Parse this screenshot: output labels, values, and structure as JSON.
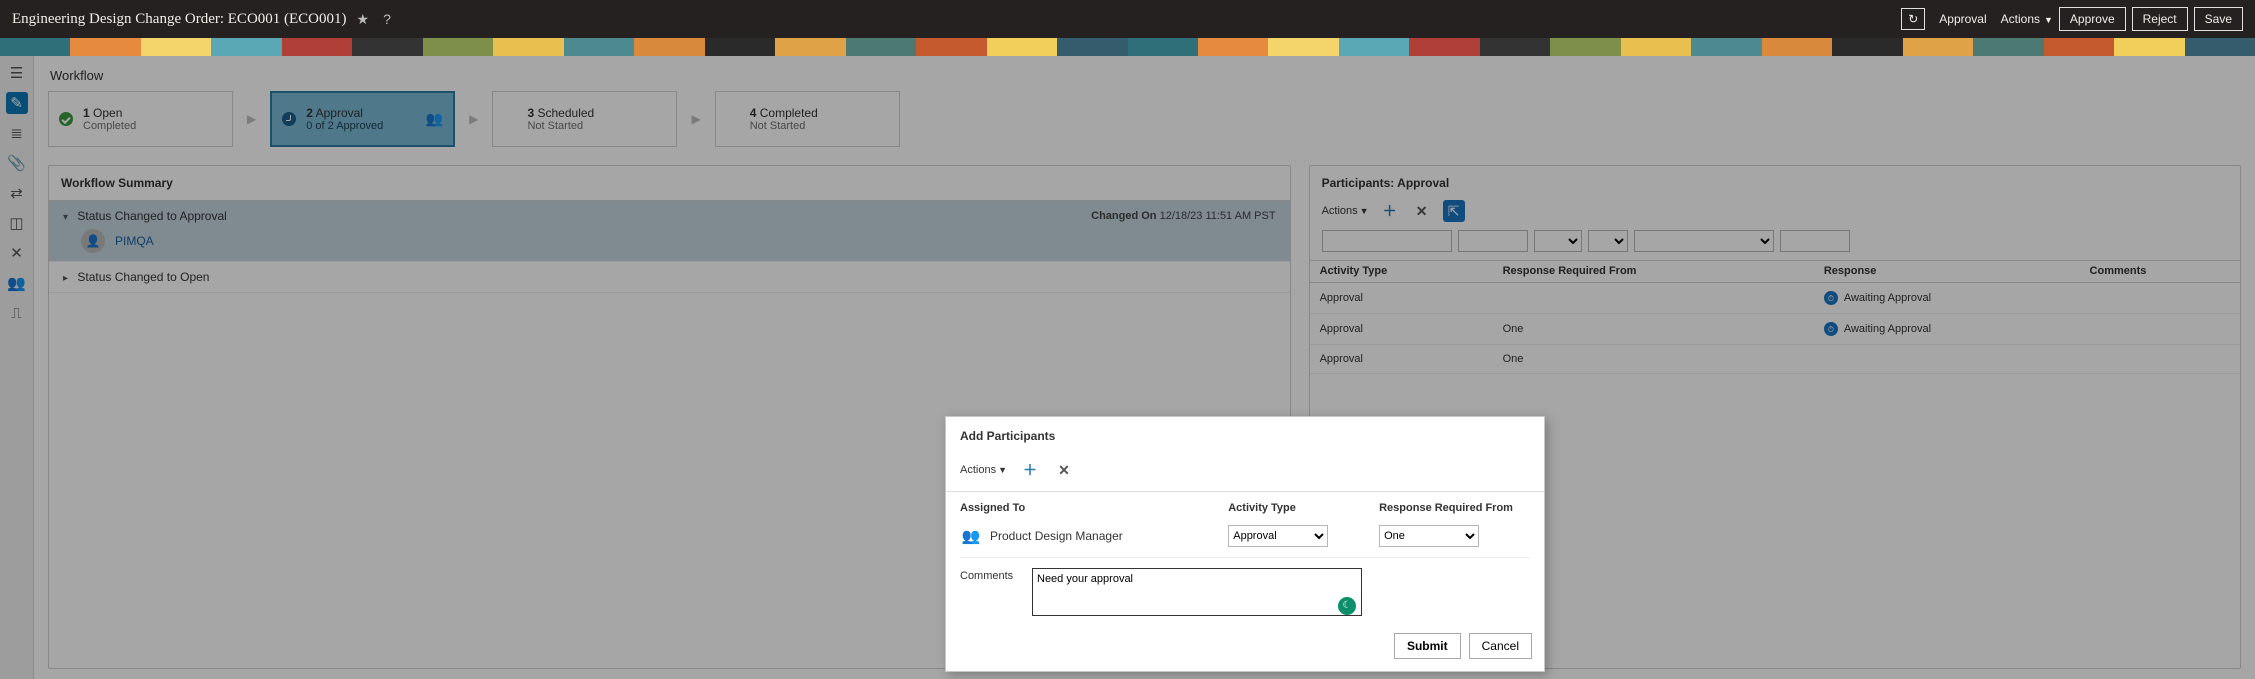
{
  "header": {
    "title": "Engineering Design Change Order: ECO001 (ECO001)",
    "approval_text": "Approval",
    "actions_text": "Actions",
    "approve_btn": "Approve",
    "reject_btn": "Reject",
    "save_btn": "Save"
  },
  "rail_icons": [
    "clipboard",
    "form",
    "list",
    "paperclip",
    "workflow",
    "chart",
    "nodes",
    "people",
    "timeline"
  ],
  "workflow": {
    "title": "Workflow",
    "steps": [
      {
        "num": "1",
        "name": "Open",
        "sub": "Completed",
        "state": "done"
      },
      {
        "num": "2",
        "name": "Approval",
        "sub": "0 of 2 Approved",
        "state": "active"
      },
      {
        "num": "3",
        "name": "Scheduled",
        "sub": "Not Started",
        "state": "future"
      },
      {
        "num": "4",
        "name": "Completed",
        "sub": "Not Started",
        "state": "future"
      }
    ]
  },
  "summary": {
    "title": "Workflow Summary",
    "events": [
      {
        "toggle": "down",
        "label": "Status Changed to Approval",
        "right_label": "Changed On",
        "right_value": "12/18/23 11:51 AM PST",
        "user": "PIMQA",
        "current": true
      },
      {
        "toggle": "right",
        "label": "Status Changed to Open",
        "right_label": "",
        "right_value": "",
        "user": "",
        "current": false
      }
    ]
  },
  "participants": {
    "title": "Participants: Approval",
    "toolbar_actions": "Actions",
    "table_headers": {
      "activity": "Activity Type",
      "rrf": "Response Required From",
      "response": "Response",
      "comments": "Comments"
    },
    "rows": [
      {
        "activity": "Approval",
        "rrf": "",
        "response": "Awaiting Approval",
        "show_dot": true
      },
      {
        "activity": "Approval",
        "rrf": "One",
        "response": "Awaiting Approval",
        "show_dot": true
      },
      {
        "activity": "Approval",
        "rrf": "One",
        "response": "",
        "show_dot": false
      }
    ]
  },
  "modal": {
    "title": "Add Participants",
    "toolbar_actions": "Actions",
    "headers": {
      "assigned": "Assigned To",
      "activity": "Activity Type",
      "rrf": "Response Required From"
    },
    "row": {
      "assignee": "Product Design Manager",
      "activity": "Approval",
      "rrf": "One"
    },
    "comments_label": "Comments",
    "comments_value": "Need your approval",
    "submit": "Submit",
    "cancel": "Cancel"
  }
}
